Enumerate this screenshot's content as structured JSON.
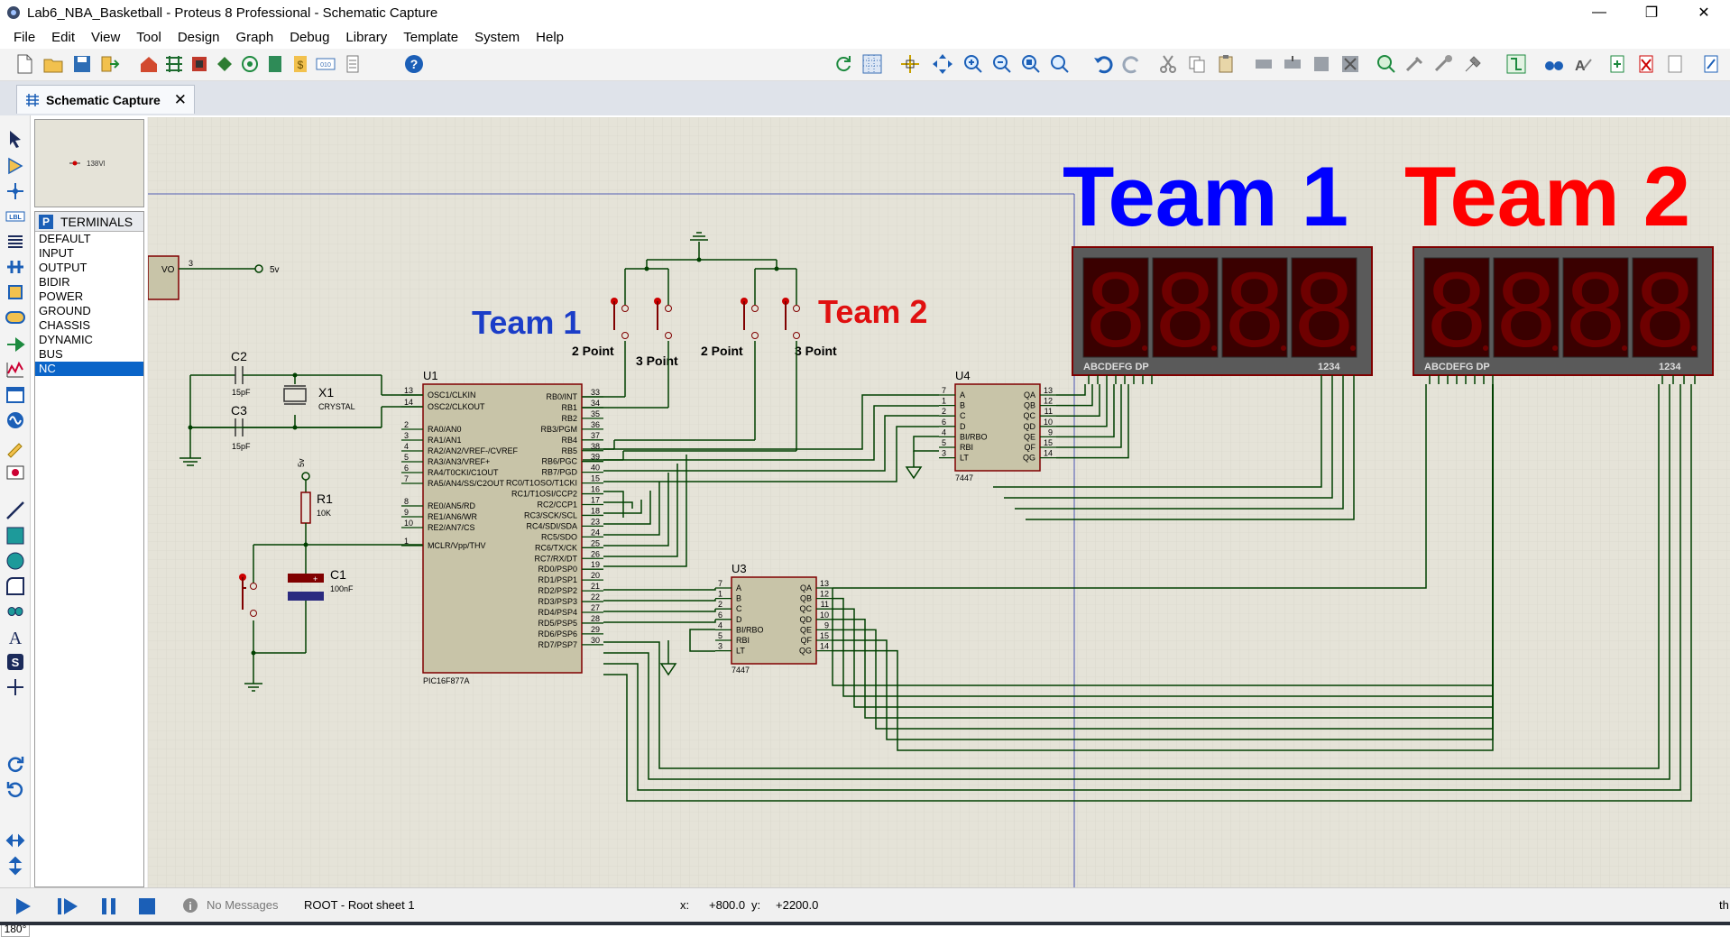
{
  "window": {
    "title": "Lab6_NBA_Basketball - Proteus 8 Professional - Schematic Capture",
    "minimize": "—",
    "maximize": "❐",
    "close": "✕"
  },
  "menu": [
    "File",
    "Edit",
    "View",
    "Tool",
    "Design",
    "Graph",
    "Debug",
    "Library",
    "Template",
    "System",
    "Help"
  ],
  "tab": {
    "label": "Schematic Capture",
    "close": "✕"
  },
  "overview": {
    "preview_label": "138Vl"
  },
  "selector": {
    "mode_badge": "P",
    "heading": "TERMINALS",
    "items": [
      "DEFAULT",
      "INPUT",
      "OUTPUT",
      "BIDIR",
      "POWER",
      "GROUND",
      "CHASSIS",
      "DYNAMIC",
      "BUS",
      "NC"
    ],
    "selected": "NC"
  },
  "rotation": {
    "angle": "180°"
  },
  "status": {
    "messages": "No Messages",
    "sheet": "ROOT - Root sheet 1",
    "x_label": "x:",
    "x_value": "+800.0",
    "y_label": "y:",
    "y_value": "+2200.0",
    "clipped": "th"
  },
  "schematic": {
    "team1_big": "Team 1",
    "team2_big": "Team 2",
    "team1_small": "Team 1",
    "team2_small": "Team 2",
    "button_labels": [
      "2 Point",
      "3 Point",
      "2 Point",
      "3 Point"
    ],
    "vo_label": "VO",
    "vo_pin": "3",
    "supply_label": "5v",
    "supply_label2": "5v",
    "c2": {
      "ref": "C2",
      "value": "15pF"
    },
    "c3": {
      "ref": "C3",
      "value": "15pF"
    },
    "x1": {
      "ref": "X1",
      "value": "CRYSTAL"
    },
    "r1": {
      "ref": "R1",
      "value": "10K"
    },
    "c1": {
      "ref": "C1",
      "value": "100nF"
    },
    "u1": {
      "ref": "U1",
      "part": "PIC16F877A",
      "left_pins": [
        {
          "num": "13",
          "name": "OSC1/CLKIN"
        },
        {
          "num": "14",
          "name": "OSC2/CLKOUT"
        },
        {
          "num": "2",
          "name": "RA0/AN0"
        },
        {
          "num": "3",
          "name": "RA1/AN1"
        },
        {
          "num": "4",
          "name": "RA2/AN2/VREF-/CVREF"
        },
        {
          "num": "5",
          "name": "RA3/AN3/VREF+"
        },
        {
          "num": "6",
          "name": "RA4/T0CKI/C1OUT"
        },
        {
          "num": "7",
          "name": "RA5/AN4/SS/C2OUT"
        },
        {
          "num": "8",
          "name": "RE0/AN5/RD"
        },
        {
          "num": "9",
          "name": "RE1/AN6/WR"
        },
        {
          "num": "10",
          "name": "RE2/AN7/CS"
        },
        {
          "num": "1",
          "name": "MCLR/Vpp/THV"
        }
      ],
      "right_pins": [
        {
          "num": "33",
          "name": "RB0/INT"
        },
        {
          "num": "34",
          "name": "RB1"
        },
        {
          "num": "35",
          "name": "RB2"
        },
        {
          "num": "36",
          "name": "RB3/PGM"
        },
        {
          "num": "37",
          "name": "RB4"
        },
        {
          "num": "38",
          "name": "RB5"
        },
        {
          "num": "39",
          "name": "RB6/PGC"
        },
        {
          "num": "40",
          "name": "RB7/PGD"
        },
        {
          "num": "15",
          "name": "RC0/T1OSO/T1CKI"
        },
        {
          "num": "16",
          "name": "RC1/T1OSI/CCP2"
        },
        {
          "num": "17",
          "name": "RC2/CCP1"
        },
        {
          "num": "18",
          "name": "RC3/SCK/SCL"
        },
        {
          "num": "23",
          "name": "RC4/SDI/SDA"
        },
        {
          "num": "24",
          "name": "RC5/SDO"
        },
        {
          "num": "25",
          "name": "RC6/TX/CK"
        },
        {
          "num": "26",
          "name": "RC7/RX/DT"
        },
        {
          "num": "19",
          "name": "RD0/PSP0"
        },
        {
          "num": "20",
          "name": "RD1/PSP1"
        },
        {
          "num": "21",
          "name": "RD2/PSP2"
        },
        {
          "num": "22",
          "name": "RD3/PSP3"
        },
        {
          "num": "27",
          "name": "RD4/PSP4"
        },
        {
          "num": "28",
          "name": "RD5/PSP5"
        },
        {
          "num": "29",
          "name": "RD6/PSP6"
        },
        {
          "num": "30",
          "name": "RD7/PSP7"
        }
      ]
    },
    "u4": {
      "ref": "U4",
      "part": "7447",
      "left_pins": [
        {
          "num": "7",
          "name": "A"
        },
        {
          "num": "1",
          "name": "B"
        },
        {
          "num": "2",
          "name": "C"
        },
        {
          "num": "6",
          "name": "D"
        },
        {
          "num": "4",
          "name": "BI/RBO"
        },
        {
          "num": "5",
          "name": "RBI"
        },
        {
          "num": "3",
          "name": "LT"
        }
      ],
      "right_pins": [
        {
          "num": "13",
          "name": "QA"
        },
        {
          "num": "12",
          "name": "QB"
        },
        {
          "num": "11",
          "name": "QC"
        },
        {
          "num": "10",
          "name": "QD"
        },
        {
          "num": "9",
          "name": "QE"
        },
        {
          "num": "15",
          "name": "QF"
        },
        {
          "num": "14",
          "name": "QG"
        }
      ]
    },
    "u3": {
      "ref": "U3",
      "part": "7447",
      "left_pins": [
        {
          "num": "7",
          "name": "A"
        },
        {
          "num": "1",
          "name": "B"
        },
        {
          "num": "2",
          "name": "C"
        },
        {
          "num": "6",
          "name": "D"
        },
        {
          "num": "4",
          "name": "BI/RBO"
        },
        {
          "num": "5",
          "name": "RBI"
        },
        {
          "num": "3",
          "name": "LT"
        }
      ],
      "right_pins": [
        {
          "num": "13",
          "name": "QA"
        },
        {
          "num": "12",
          "name": "QB"
        },
        {
          "num": "11",
          "name": "QC"
        },
        {
          "num": "10",
          "name": "QD"
        },
        {
          "num": "9",
          "name": "QE"
        },
        {
          "num": "15",
          "name": "QF"
        },
        {
          "num": "14",
          "name": "QG"
        }
      ]
    },
    "display": {
      "segments_label": "ABCDEFG  DP",
      "digits_label": "1234",
      "digit_glyph": "8"
    },
    "colors": {
      "grid": "#d6d3c8",
      "paper": "#e5e3d8",
      "wire": "#004000",
      "chip": "#c8c4a8",
      "chip_border": "#800000",
      "team1": "#0000ff",
      "team2": "#ff0000",
      "display_bg": "#5a5a5a",
      "digit": "#6e0000"
    }
  }
}
